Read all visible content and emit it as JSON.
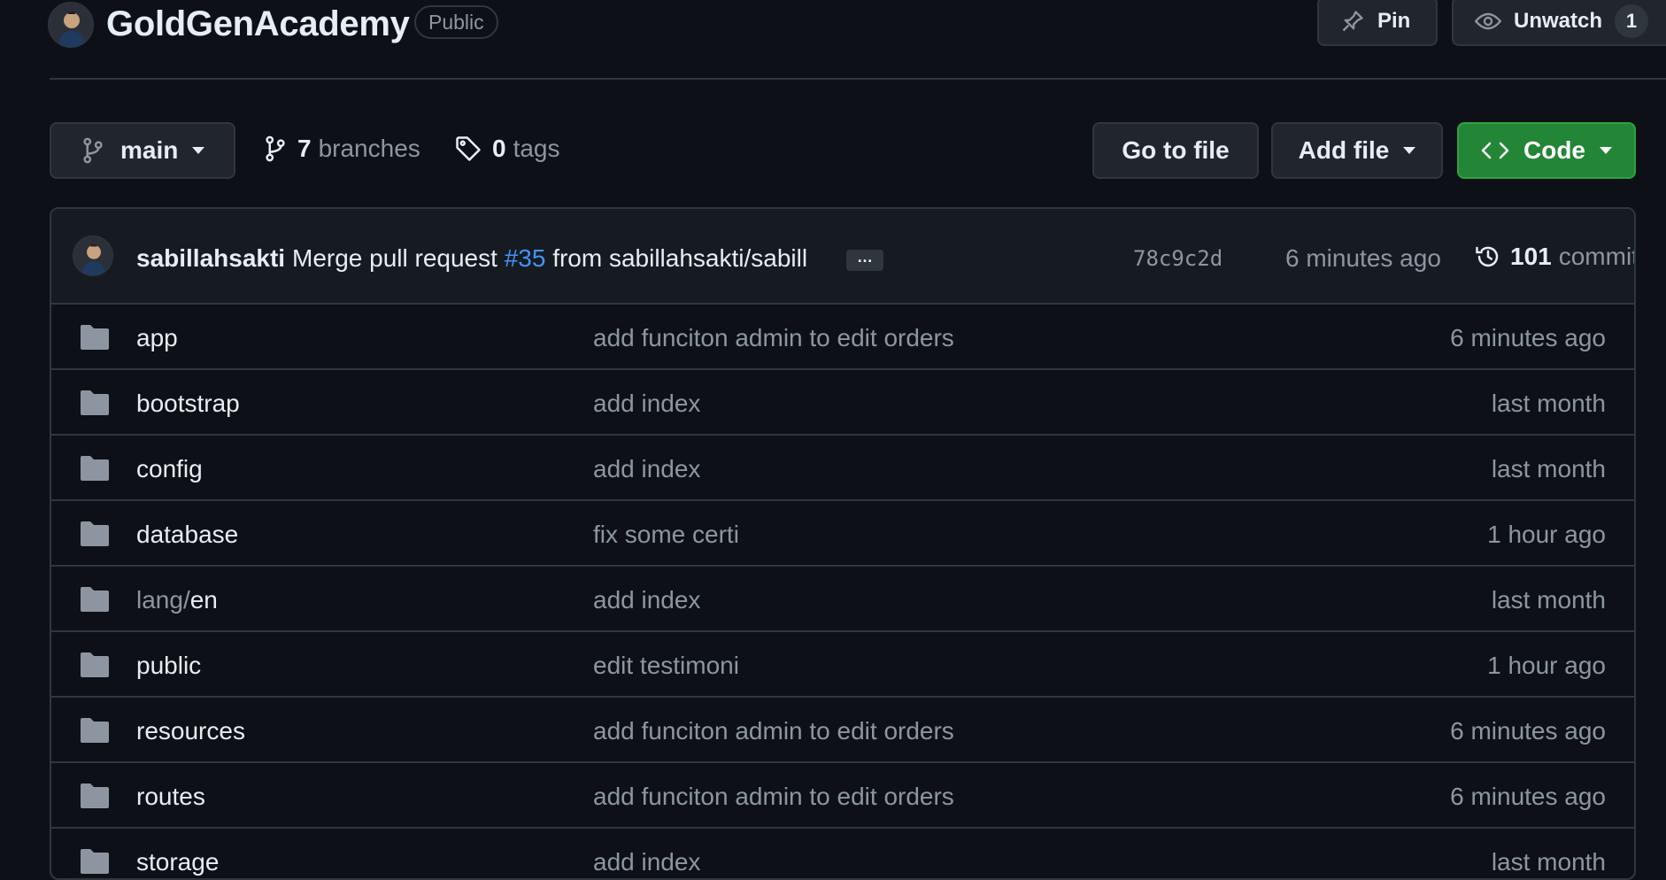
{
  "repo": {
    "name": "GoldGenAcademy",
    "visibility": "Public",
    "pin_label": "Pin",
    "unwatch_label": "Unwatch",
    "watch_count": "1"
  },
  "toolbar": {
    "branch": "main",
    "branches_count": "7",
    "branches_label": "branches",
    "tags_count": "0",
    "tags_label": "tags",
    "goto_file": "Go to file",
    "add_file": "Add file",
    "code": "Code"
  },
  "commit": {
    "author": "sabillahsakti",
    "message_prefix": "Merge pull request",
    "pr_number": "#35",
    "message_suffix": "from sabillahsakti/sabill",
    "ellipsis": "…",
    "sha": "78c9c2d",
    "time": "6 minutes ago",
    "count": "101",
    "count_label": "commits"
  },
  "files": [
    {
      "name": "app",
      "prefix": "",
      "message": "add funciton admin to edit orders",
      "age": "6 minutes ago"
    },
    {
      "name": "bootstrap",
      "prefix": "",
      "message": "add index",
      "age": "last month"
    },
    {
      "name": "config",
      "prefix": "",
      "message": "add index",
      "age": "last month"
    },
    {
      "name": "database",
      "prefix": "",
      "message": "fix some certi",
      "age": "1 hour ago"
    },
    {
      "name": "en",
      "prefix": "lang/",
      "message": "add index",
      "age": "last month"
    },
    {
      "name": "public",
      "prefix": "",
      "message": "edit testimoni",
      "age": "1 hour ago"
    },
    {
      "name": "resources",
      "prefix": "",
      "message": "add funciton admin to edit orders",
      "age": "6 minutes ago"
    },
    {
      "name": "routes",
      "prefix": "",
      "message": "add funciton admin to edit orders",
      "age": "6 minutes ago"
    },
    {
      "name": "storage",
      "prefix": "",
      "message": "add index",
      "age": "last month"
    }
  ],
  "icons": {
    "branch": "git-branch-icon",
    "tag": "tag-icon",
    "pin": "pin-icon",
    "eye": "eye-icon",
    "code": "code-icon",
    "history": "history-icon",
    "folder": "folder-icon"
  },
  "colors": {
    "background": "#0d1117",
    "border": "#30363d",
    "muted_text": "#8d96a0",
    "link": "#4493f8",
    "code_button": "#238636"
  }
}
